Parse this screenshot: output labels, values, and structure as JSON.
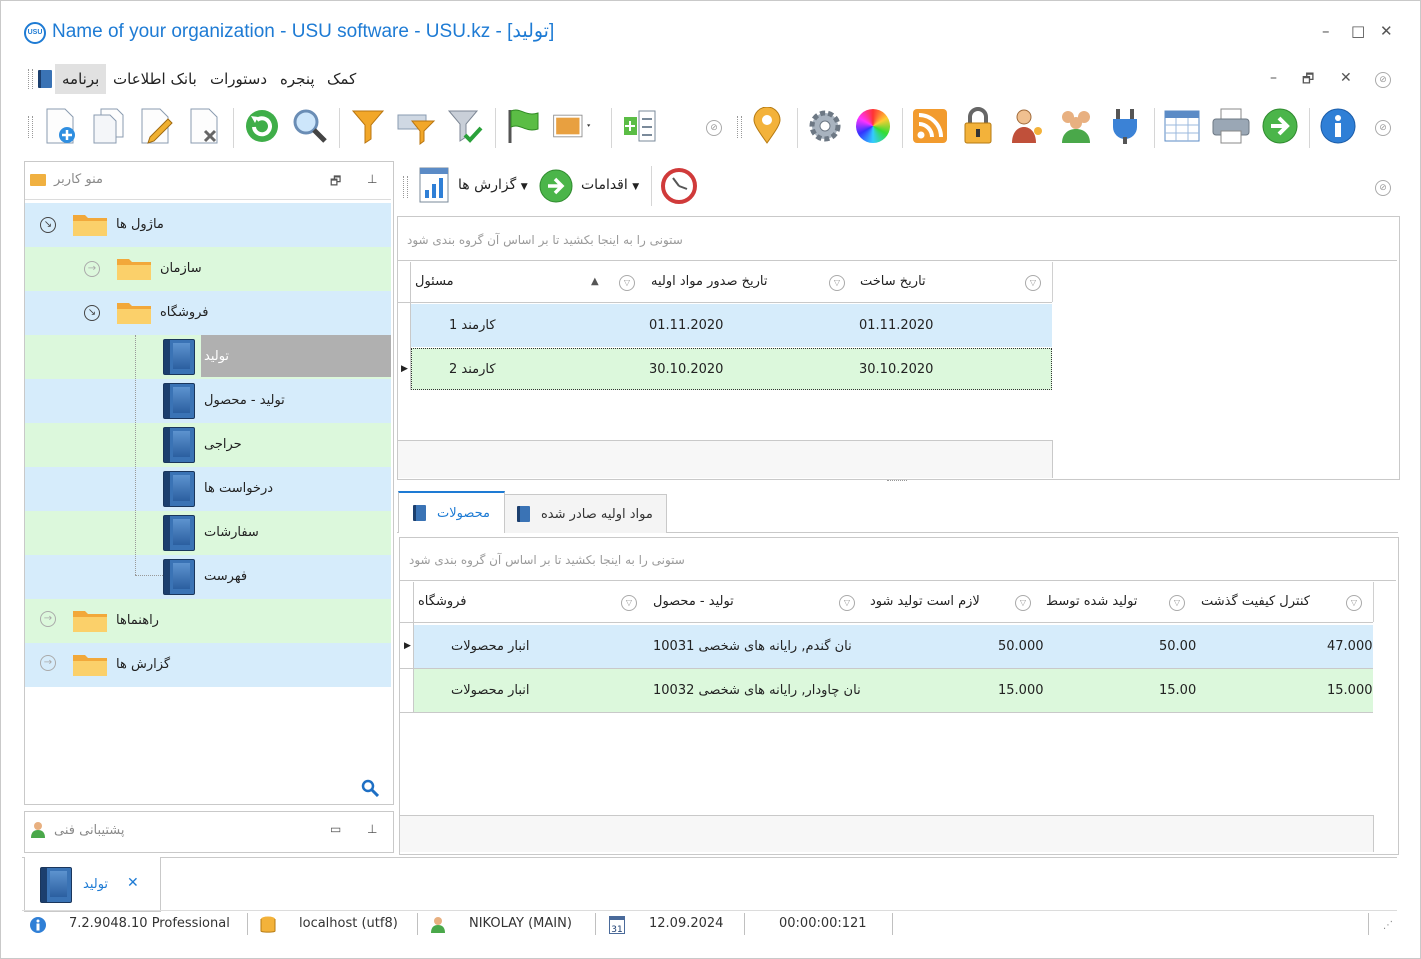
{
  "window": {
    "title": "Name of your organization - USU software - USU.kz - [تولید]",
    "logo_text": "USU",
    "controls": [
      "–",
      "□",
      "✕"
    ]
  },
  "menu": {
    "items": [
      "کمک",
      "پنجره",
      "دستورات",
      "بانک اطلاعات",
      "برنامه"
    ],
    "active": "برنامه",
    "mdi_controls": [
      "–",
      "🗗",
      "✕"
    ]
  },
  "toolbar": {
    "left_icons": [
      "new-icon",
      "copy-icon",
      "edit-icon",
      "delete-icon",
      "refresh-icon",
      "search-icon",
      "filter-icon",
      "filter-edit-icon",
      "filter-apply-icon",
      "flag-icon",
      "image-icon",
      "columns-icon"
    ],
    "right_icons": [
      "location-pin-icon",
      "settings-gear-icon",
      "color-wheel-icon",
      "rss-icon",
      "lock-icon",
      "user-key-icon",
      "users-icon",
      "plug-icon",
      "table-icon",
      "printer-icon",
      "go-arrow-icon",
      "info-icon"
    ]
  },
  "left_panel": {
    "title": "منو کاربر",
    "tree": [
      {
        "label": "ماژول ها",
        "level": 0,
        "expanded": true,
        "type": "folder"
      },
      {
        "label": "سازمان",
        "level": 1,
        "expanded": false,
        "type": "folder"
      },
      {
        "label": "فروشگاه",
        "level": 1,
        "expanded": true,
        "type": "folder"
      },
      {
        "label": "تولید",
        "level": 2,
        "type": "book",
        "selected": true
      },
      {
        "label": "تولید - محصول",
        "level": 2,
        "type": "book"
      },
      {
        "label": "حراجی",
        "level": 2,
        "type": "book"
      },
      {
        "label": "درخواست ها",
        "level": 2,
        "type": "book"
      },
      {
        "label": "سفارشات",
        "level": 2,
        "type": "book"
      },
      {
        "label": "فهرست",
        "level": 2,
        "type": "book"
      },
      {
        "label": "راهنماها",
        "level": 0,
        "expanded": false,
        "type": "folder"
      },
      {
        "label": "گزارش ها",
        "level": 0,
        "expanded": false,
        "type": "folder"
      }
    ],
    "support_title": "پشتیبانی فنی"
  },
  "action_bar": {
    "reports_label": "گزارش ها",
    "actions_label": "اقدامات"
  },
  "top_grid": {
    "group_hint": "ستونی را به اینجا بکشید تا بر اساس آن گروه بندی شود",
    "columns": [
      "مسئول",
      "تاریخ صدور مواد اولیه",
      "تاریخ ساخت"
    ],
    "rows": [
      [
        "کارمند 1",
        "01.11.2020",
        "01.11.2020"
      ],
      [
        "کارمند 2",
        "30.10.2020",
        "30.10.2020"
      ]
    ]
  },
  "tabs": {
    "items": [
      "محصولات",
      "مواد اولیه صادر شده"
    ],
    "active": "محصولات"
  },
  "bottom_grid": {
    "group_hint": "ستونی را به اینجا بکشید تا بر اساس آن گروه بندی شود",
    "columns": [
      "فروشگاه",
      "تولید - محصول",
      "لازم است تولید شود",
      "تولید شده توسط",
      "کنترل کیفیت گذشت"
    ],
    "rows": [
      [
        "انبار محصولات",
        "10031 نان گندم, رایانه های شخصی",
        "50.000",
        "50.00",
        "47.000"
      ],
      [
        "انبار محصولات",
        "10032 نان چاودار, رایانه های شخصی",
        "15.000",
        "15.00",
        "15.000"
      ]
    ]
  },
  "doc_tab": {
    "label": "تولید",
    "close": "✕"
  },
  "status_bar": {
    "version": "7.2.9048.10 Professional",
    "database": "localhost (utf8)",
    "user": "NIKOLAY (MAIN)",
    "calendar_day": "31",
    "date": "12.09.2024",
    "timer": "00:00:00:121"
  }
}
